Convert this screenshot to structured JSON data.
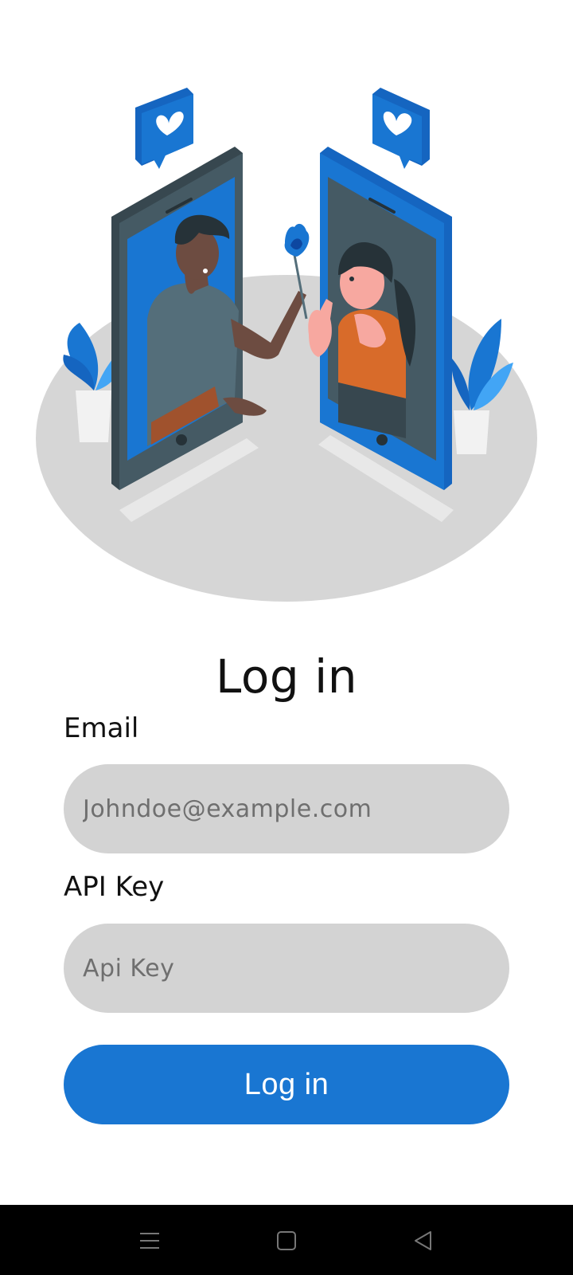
{
  "login": {
    "title": "Log in",
    "email_label": "Email",
    "email_placeholder": "Johndoe@example.com",
    "api_key_label": "API Key",
    "api_key_placeholder": "Api Key",
    "submit_label": "Log in"
  },
  "illustration": {
    "left_phone_color": "#455a64",
    "right_phone_color": "#1976d2",
    "base_color": "#d6d6d6",
    "icons": [
      "heart-bubble-icon",
      "heart-bubble-icon",
      "plant-icon",
      "plant-icon",
      "flower-icon"
    ]
  },
  "theme": {
    "accent": "#1976d2",
    "input_bg": "#d3d3d3",
    "background": "#ffffff",
    "nav_bar_bg": "#000000"
  },
  "nav_bar": {
    "icons": [
      "menu-icon",
      "home-square-icon",
      "back-triangle-icon"
    ]
  }
}
